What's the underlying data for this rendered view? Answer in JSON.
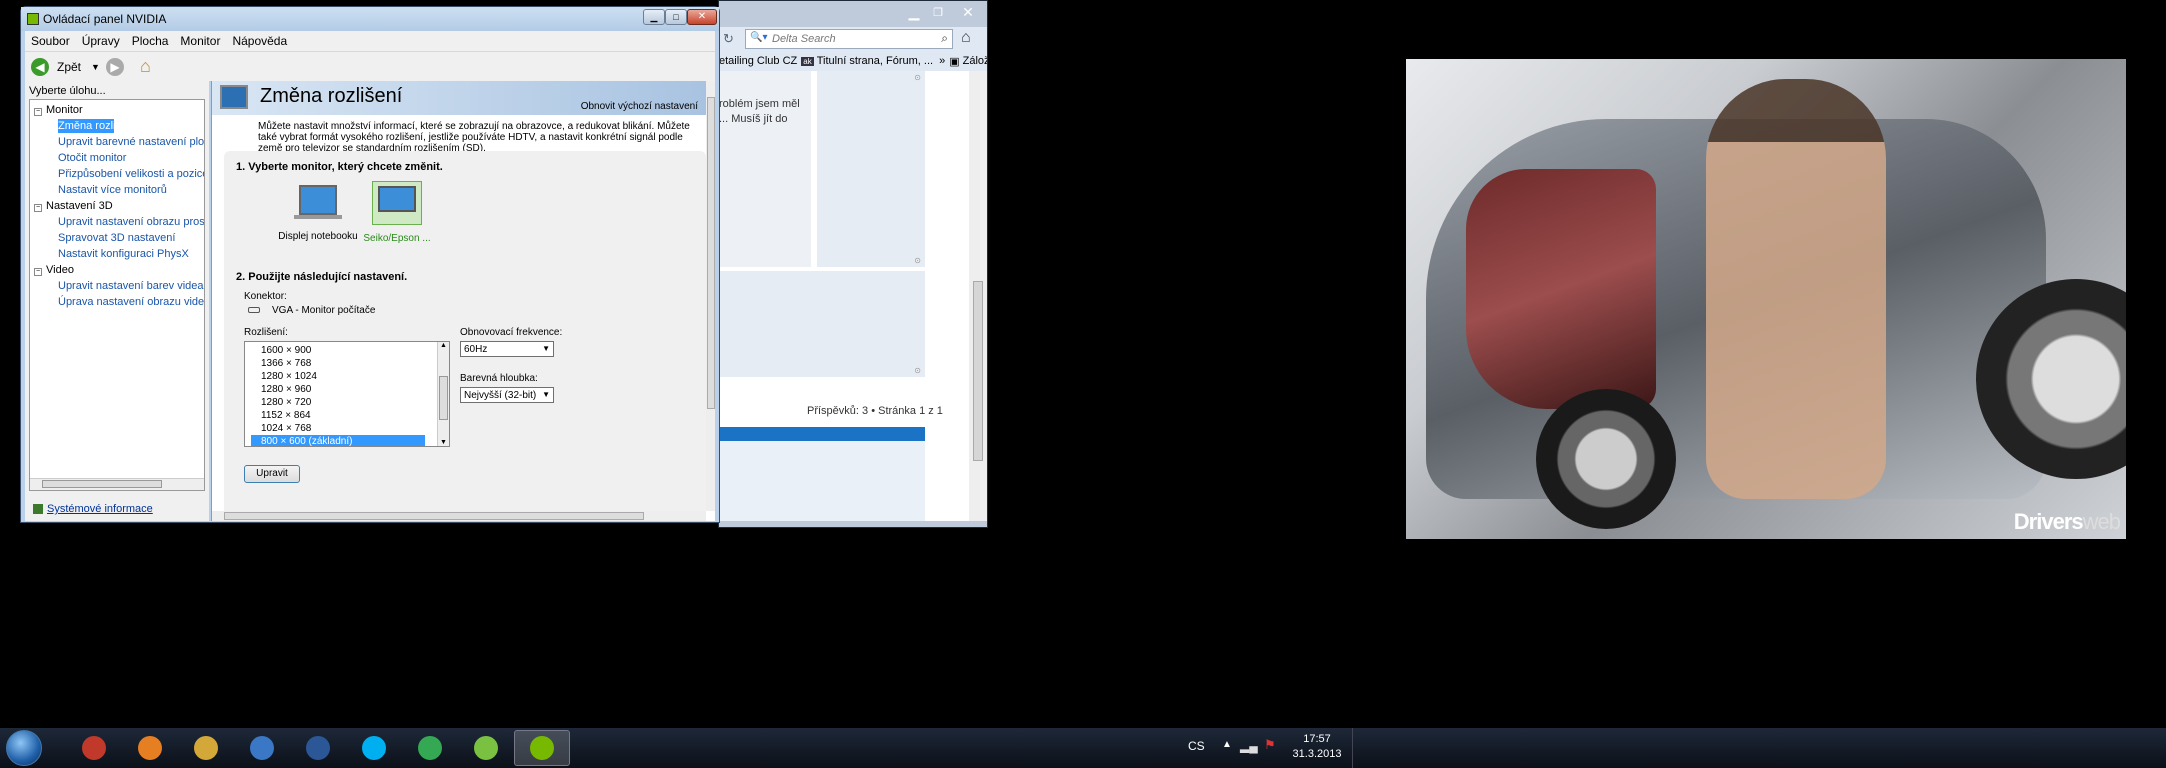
{
  "nvidia": {
    "title": "Ovládací panel NVIDIA",
    "menu": [
      "Soubor",
      "Úpravy",
      "Plocha",
      "Monitor",
      "Nápověda"
    ],
    "back_label": "Zpět",
    "task_title": "Vyberte úlohu...",
    "tree": [
      {
        "label": "Monitor",
        "children": [
          "Změna rozlišení",
          "Upravit barevné nastavení plochy",
          "Otočit monitor",
          "Přizpůsobení velikosti a pozice plochy",
          "Nastavit více monitorů"
        ]
      },
      {
        "label": "Nastavení 3D",
        "children": [
          "Upravit nastavení obrazu prostřednictvím n",
          "Spravovat 3D nastavení",
          "Nastavit konfiguraci PhysX"
        ]
      },
      {
        "label": "Video",
        "children": [
          "Upravit nastavení barev videa",
          "Úprava nastavení obrazu videa"
        ]
      }
    ],
    "sysinfo": "Systémové informace",
    "page_title": "Změna rozlišení",
    "restore": "Obnovit výchozí nastavení",
    "desc": "Můžete nastavit množství informací, které se zobrazují na obrazovce, a redukovat blikání. Můžete také vybrat formát vysokého rozlišení, jestliže používáte HDTV, a nastavit konkrétní signál podle země pro televizor se standardním rozlišením (SD).",
    "step1": "1. Vyberte monitor, který chcete změnit.",
    "monitor1": "Displej notebooku",
    "monitor2": "Seiko/Epson ...",
    "step2": "2. Použijte následující nastavení.",
    "connector_label": "Konektor:",
    "connector_value": "VGA - Monitor počítače",
    "resolution_label": "Rozlišení:",
    "resolutions": [
      "1600 × 900",
      "1366 × 768",
      "1280 × 1024",
      "1280 × 960",
      "1280 × 720",
      "1152 × 864",
      "1024 × 768",
      "800 × 600 (základní)"
    ],
    "refresh_label": "Obnovovací frekvence:",
    "refresh_value": "60Hz",
    "depth_label": "Barevná hloubka:",
    "depth_value": "Nejvyšší (32-bit)",
    "apply": "Upravit"
  },
  "browser": {
    "search_placeholder": "Delta Search",
    "bm1": "etailing Club CZ",
    "bm2": "Titulní strana, Fórum, ...",
    "bm_more": "»",
    "bm3": "Záložky",
    "post1": "roblém jsem měl",
    "post2": "... Musíš jít do",
    "posts": "Příspěvků: 3 • Stránka 1 z 1"
  },
  "wallpaper": {
    "logo": "Drivers",
    "logo2": "web"
  },
  "taskbar": {
    "lang": "CS",
    "time": "17:57",
    "date": "31.3.2013"
  }
}
